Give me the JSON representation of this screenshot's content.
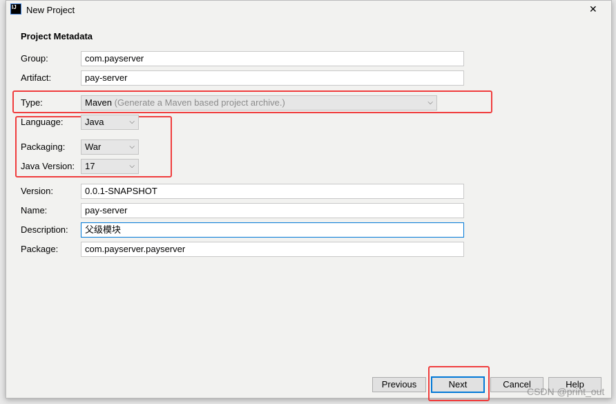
{
  "window": {
    "title": "New Project",
    "close": "✕"
  },
  "section_title": "Project Metadata",
  "fields": {
    "group": {
      "label": "Group:",
      "value": "com.payserver"
    },
    "artifact": {
      "label": "Artifact:",
      "value": "pay-server"
    },
    "type": {
      "label": "Type:",
      "value": "Maven",
      "hint": "(Generate a Maven based project archive.)"
    },
    "language": {
      "label": "Language:",
      "value": "Java"
    },
    "packaging": {
      "label": "Packaging:",
      "value": "War"
    },
    "java_version": {
      "label": "Java Version:",
      "value": "17"
    },
    "version": {
      "label": "Version:",
      "value": "0.0.1-SNAPSHOT"
    },
    "name": {
      "label": "Name:",
      "value": "pay-server"
    },
    "description": {
      "label": "Description:",
      "value": "父级模块"
    },
    "package": {
      "label": "Package:",
      "value": "com.payserver.payserver"
    }
  },
  "buttons": {
    "previous": "Previous",
    "next": "Next",
    "cancel": "Cancel",
    "help": "Help"
  },
  "watermark": "CSDN @print_out",
  "colors": {
    "highlight": "#f03c3c",
    "focus": "#0078d7"
  }
}
